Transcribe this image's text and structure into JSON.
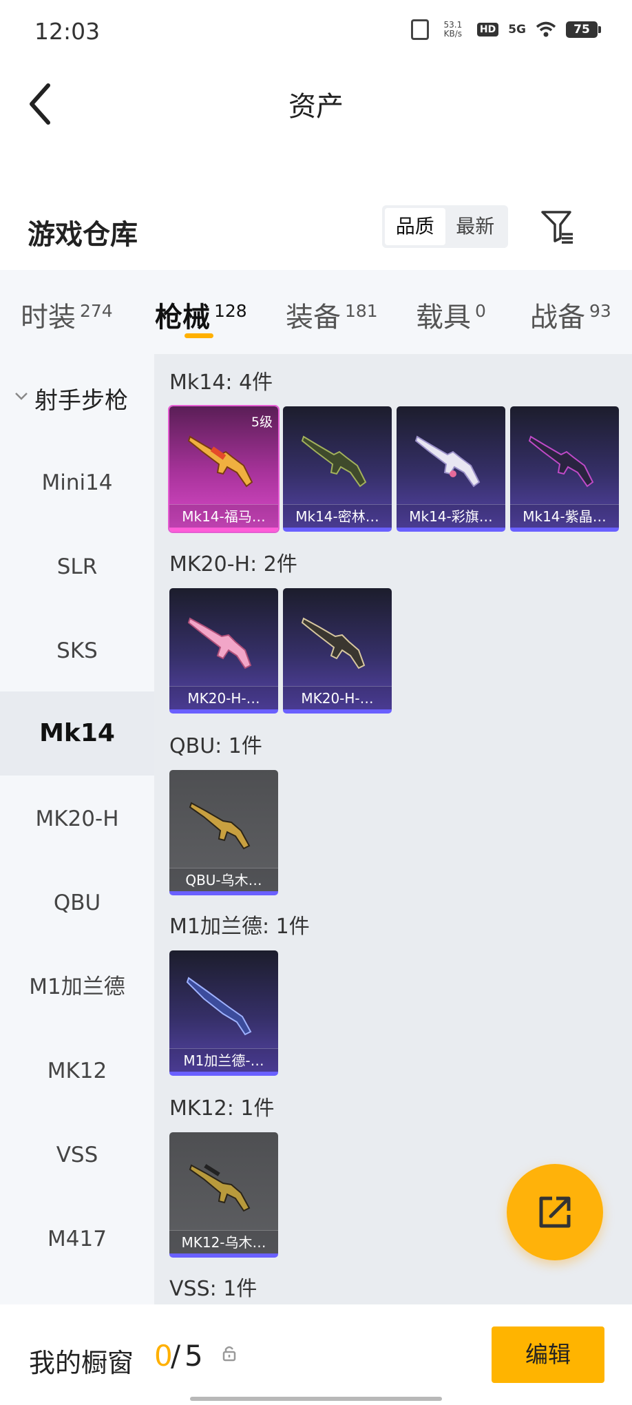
{
  "status": {
    "time": "12:03",
    "net_speed": "53.1",
    "net_unit": "KB/s",
    "hd": "HD",
    "signal": "5G",
    "battery": "75"
  },
  "header": {
    "title": "资产"
  },
  "warehouse": {
    "title": "游戏仓库",
    "sort_options": [
      "品质",
      "最新"
    ],
    "sort_selected": "品质"
  },
  "tabs": [
    {
      "label": "时装",
      "count": "274"
    },
    {
      "label": "枪械",
      "count": "128",
      "active": true
    },
    {
      "label": "装备",
      "count": "181"
    },
    {
      "label": "载具",
      "count": "0"
    },
    {
      "label": "战备",
      "count": "93"
    }
  ],
  "sidebar": {
    "category": "射手步枪",
    "items": [
      "Mini14",
      "SLR",
      "SKS",
      "Mk14",
      "MK20-H",
      "QBU",
      "M1加兰德",
      "MK12",
      "VSS",
      "M417"
    ],
    "selected": "Mk14"
  },
  "groups": [
    {
      "title": "Mk14: 4件",
      "items": [
        {
          "label": "Mk14-福马…",
          "level": "5级",
          "color": "pink"
        },
        {
          "label": "Mk14-密林…",
          "color": "purple"
        },
        {
          "label": "Mk14-彩旗…",
          "color": "purple"
        },
        {
          "label": "Mk14-紫晶…",
          "color": "purple"
        }
      ]
    },
    {
      "title": "MK20-H: 2件",
      "items": [
        {
          "label": "MK20-H-…",
          "color": "purple"
        },
        {
          "label": "MK20-H-…",
          "color": "purple"
        }
      ]
    },
    {
      "title": "QBU: 1件",
      "items": [
        {
          "label": "QBU-乌木…",
          "color": "gray"
        }
      ]
    },
    {
      "title": "M1加兰德: 1件",
      "items": [
        {
          "label": "M1加兰德-…",
          "color": "purple"
        }
      ]
    },
    {
      "title": "MK12: 1件",
      "items": [
        {
          "label": "MK12-乌木…",
          "color": "gray"
        }
      ]
    },
    {
      "title": "VSS: 1件",
      "items": []
    }
  ],
  "bottom": {
    "window_label": "我的橱窗",
    "count_current": "0",
    "count_sep": "/",
    "count_max": "5",
    "edit_label": "编辑"
  },
  "colors": {
    "accent": "#ffb000",
    "tier_purple": "#6a60ff",
    "tier_pink": "#ff5dd8"
  }
}
